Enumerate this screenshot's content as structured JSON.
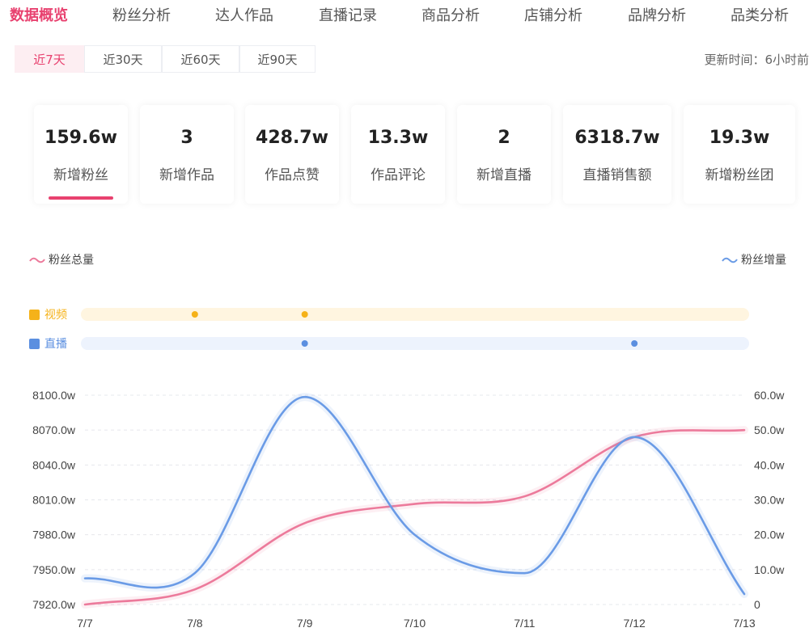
{
  "nav": {
    "tabs": [
      "数据概览",
      "粉丝分析",
      "达人作品",
      "直播记录",
      "商品分析",
      "店铺分析",
      "品牌分析",
      "品类分析"
    ],
    "active_index": 0
  },
  "range": {
    "options": [
      "近7天",
      "近30天",
      "近60天",
      "近90天"
    ],
    "active_index": 0,
    "update_time": "更新时间：6小时前"
  },
  "metrics": [
    {
      "value": "159.6w",
      "label": "新增粉丝"
    },
    {
      "value": "3",
      "label": "新增作品"
    },
    {
      "value": "428.7w",
      "label": "作品点赞"
    },
    {
      "value": "13.3w",
      "label": "作品评论"
    },
    {
      "value": "2",
      "label": "新增直播"
    },
    {
      "value": "6318.7w",
      "label": "直播销售额"
    },
    {
      "value": "19.3w",
      "label": "新增粉丝团"
    }
  ],
  "colors": {
    "accent": "#e8416f",
    "total_line": "#ec7a9b",
    "increase_line": "#6a9be6",
    "video": "#f5b21a",
    "live": "#5b8fe0"
  },
  "chart_data": {
    "type": "line",
    "x": [
      "7/7",
      "7/8",
      "7/9",
      "7/10",
      "7/11",
      "7/12",
      "7/13"
    ],
    "series": [
      {
        "name": "粉丝总量",
        "axis": "left",
        "values": [
          7920.0,
          7933.0,
          7990.0,
          8006.5,
          8013.0,
          8064.0,
          8070.0
        ]
      },
      {
        "name": "粉丝增量",
        "axis": "right",
        "values": [
          7.5,
          9.0,
          59.5,
          20.0,
          9.0,
          48.0,
          3.0
        ]
      }
    ],
    "y_left": {
      "ticks": [
        7920,
        7950,
        7980,
        8010,
        8040,
        8070,
        8100
      ],
      "tick_labels": [
        "7920.0w",
        "7950.0w",
        "7980.0w",
        "8010.0w",
        "8040.0w",
        "8070.0w",
        "8100.0w"
      ],
      "range": [
        7920,
        8100
      ]
    },
    "y_right": {
      "ticks": [
        0,
        10,
        20,
        30,
        40,
        50,
        60
      ],
      "tick_labels": [
        "0",
        "10.0w",
        "20.0w",
        "30.0w",
        "40.0w",
        "50.0w",
        "60.0w"
      ],
      "range": [
        0,
        60
      ]
    },
    "events": [
      {
        "name": "视频",
        "x": [
          8.0,
          9.0
        ]
      },
      {
        "name": "直播",
        "x": [
          9.0,
          12.0
        ]
      }
    ],
    "grid": true,
    "legend": [
      {
        "name": "粉丝总量",
        "placement": "top-left"
      },
      {
        "name": "粉丝增量",
        "placement": "top-right"
      }
    ]
  }
}
